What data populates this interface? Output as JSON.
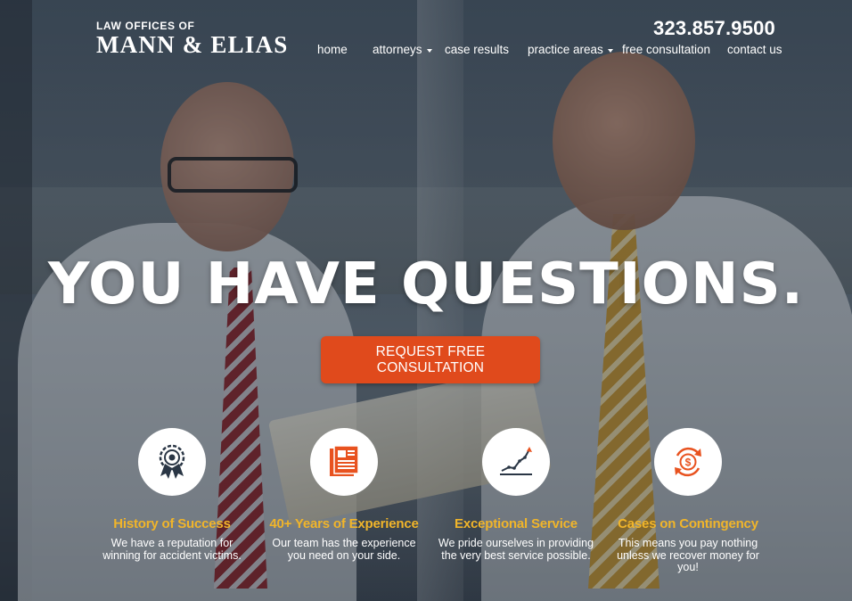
{
  "header": {
    "logo_small": "LAW OFFICES OF",
    "logo_big": "MANN & ELIAS",
    "phone": "323.857.9500",
    "nav": [
      {
        "label": "home",
        "dropdown": false
      },
      {
        "label": "attorneys",
        "dropdown": true
      },
      {
        "label": "case results",
        "dropdown": false
      },
      {
        "label": "practice areas",
        "dropdown": true
      },
      {
        "label": "free consultation",
        "dropdown": false
      },
      {
        "label": "contact us",
        "dropdown": false
      }
    ]
  },
  "hero": {
    "headline": "YOU HAVE QUESTIONS.",
    "cta_label": "REQUEST FREE CONSULTATION"
  },
  "features": [
    {
      "icon": "award-ribbon-icon",
      "title": "History of Success",
      "desc": "We have a reputation for winning for accident victims."
    },
    {
      "icon": "newspaper-icon",
      "title": "40+ Years of Experience",
      "desc": "Our team has the experience you need on your side."
    },
    {
      "icon": "growth-chart-icon",
      "title": "Exceptional Service",
      "desc": "We pride ourselves in providing the very best service possible."
    },
    {
      "icon": "dollar-cycle-icon",
      "title": "Cases on Contingency",
      "desc": "This means you pay nothing unless we recover money for you!"
    }
  ],
  "colors": {
    "accent_orange": "#e04a1c",
    "feature_title": "#f1b52a",
    "icon_orange": "#e8521f",
    "icon_navy": "#2a3645"
  }
}
